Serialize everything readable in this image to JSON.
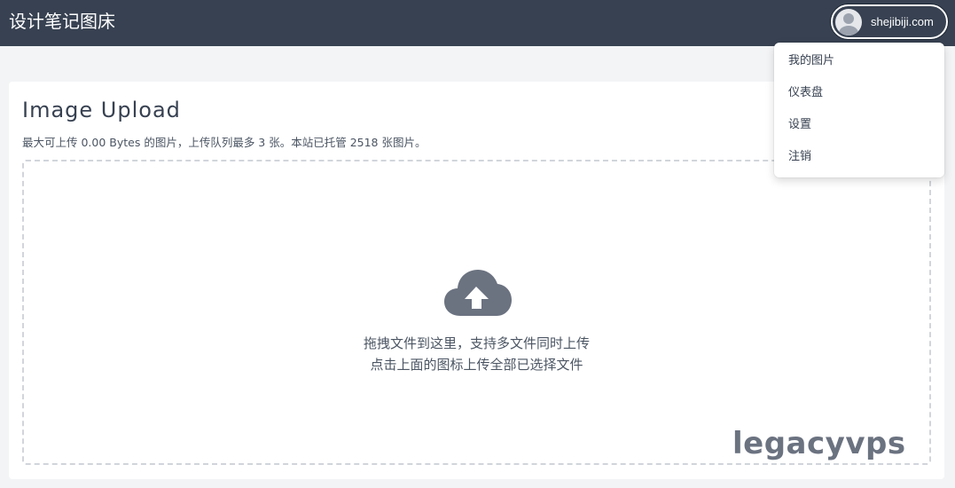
{
  "header": {
    "brand": "设计笔记图床",
    "user_name": "shejibiji.com",
    "colors": {
      "bar": "#374151",
      "text": "#ffffff"
    }
  },
  "user_menu": {
    "items": [
      {
        "label": "我的图片"
      },
      {
        "label": "仪表盘"
      },
      {
        "label": "设置"
      },
      {
        "label": "注销"
      }
    ]
  },
  "upload": {
    "title": "Image Upload",
    "subtitle": "最大可上传 0.00 Bytes 的图片，上传队列最多 3 张。本站已托管 2518 张图片。",
    "dropzone": {
      "icon": "cloud-upload-icon",
      "hint_line1": "拖拽文件到这里，支持多文件同时上传",
      "hint_line2": "点击上面的图标上传全部已选择文件"
    }
  },
  "watermark": "legacyvps"
}
